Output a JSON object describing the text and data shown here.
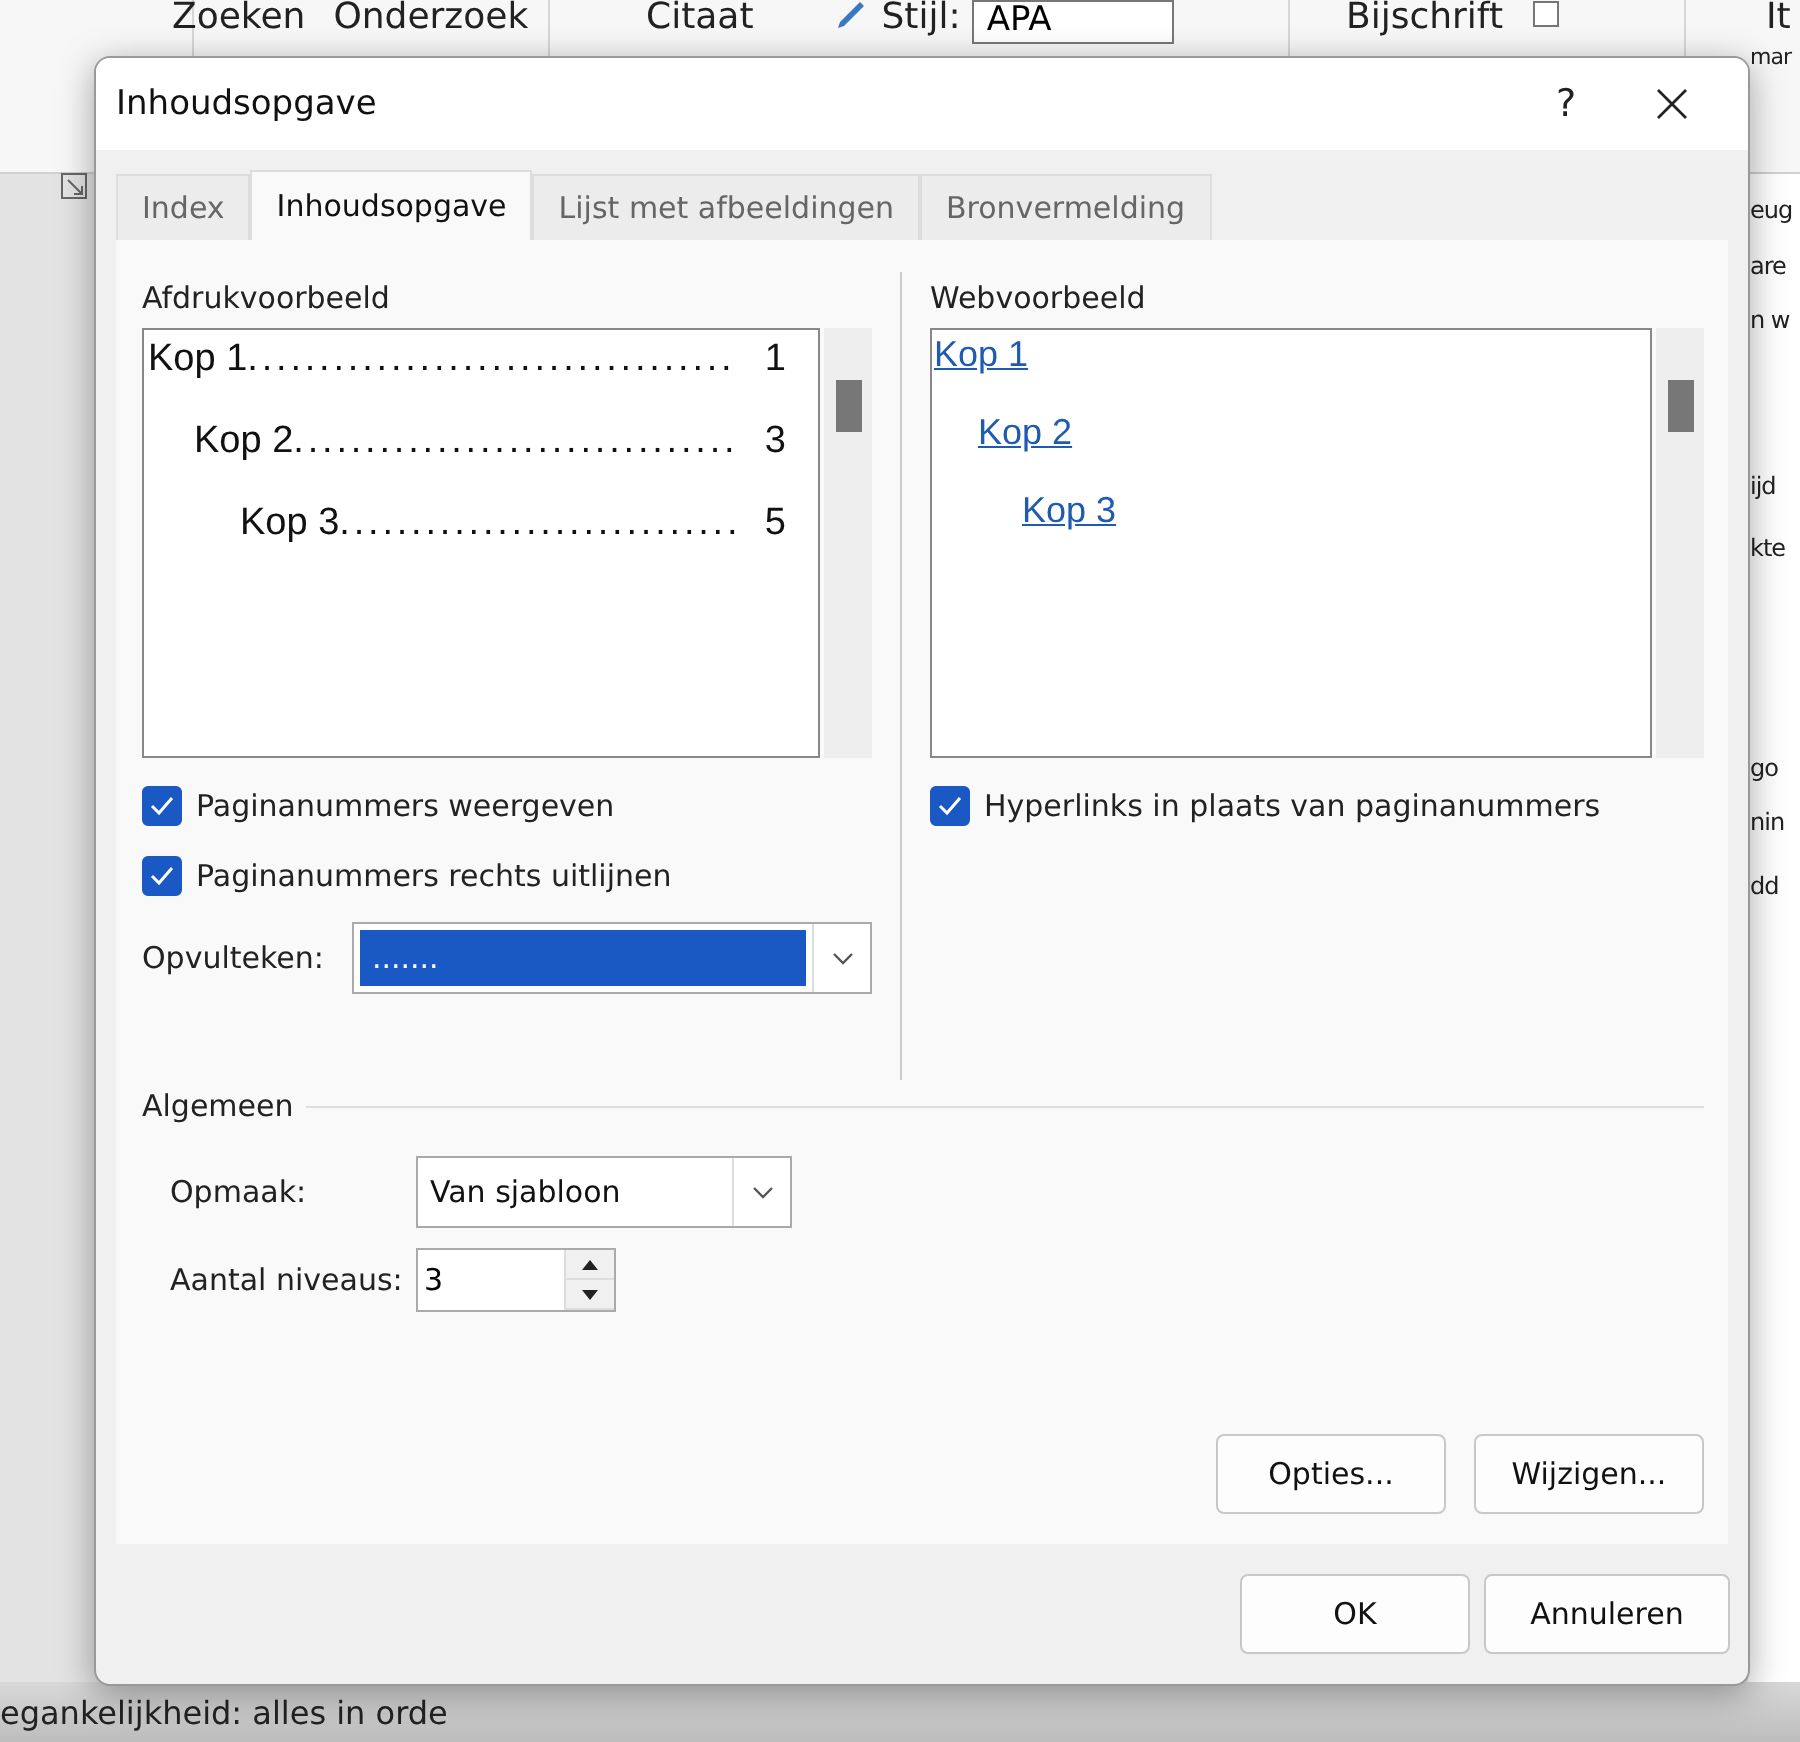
{
  "background": {
    "ribbon_items": [
      {
        "text": "Zoeken"
      },
      {
        "text": "Onderzoek"
      },
      {
        "text": "Citaat"
      },
      {
        "text": "Stijl:"
      },
      {
        "text": "APA"
      },
      {
        "text": "Bijschrift"
      },
      {
        "text": "It"
      }
    ],
    "ribbon_fragment": "mar",
    "document_fragments": [
      "eug",
      "are",
      "n w",
      "ijd",
      "kte",
      "go",
      "nin",
      "dd"
    ],
    "status_bar": "egankelijkheid: alles in orde"
  },
  "dialog": {
    "title": "Inhoudsopgave",
    "help": "?",
    "tabs": [
      {
        "label": "Index",
        "selected": false
      },
      {
        "label": "Inhoudsopgave",
        "selected": true
      },
      {
        "label": "Lijst met afbeeldingen",
        "selected": false
      },
      {
        "label": "Bronvermelding",
        "selected": false
      }
    ],
    "print_preview": {
      "label": "Afdrukvoorbeeld",
      "entries": [
        {
          "text": "Kop 1",
          "leader": "..................................",
          "page": "1"
        },
        {
          "text": "Kop 2",
          "leader": "...............................",
          "page": "3"
        },
        {
          "text": "Kop 3",
          "leader": " ............................",
          "page": "5"
        }
      ]
    },
    "print_options": [
      {
        "label": "Paginanummers weergeven",
        "checked": true
      },
      {
        "label": "Paginanummers rechts uitlijnen",
        "checked": true
      }
    ],
    "fill_char": {
      "label": "Opvulteken:",
      "value": "......."
    },
    "web_preview": {
      "label": "Webvoorbeeld",
      "entries": [
        "Kop 1",
        "Kop 2",
        "Kop 3"
      ]
    },
    "web_options": [
      {
        "label": "Hyperlinks in plaats van paginanummers",
        "checked": true
      }
    ],
    "general": {
      "label": "Algemeen",
      "format_label": "Opmaak:",
      "format_value": "Van sjabloon",
      "levels_label": "Aantal niveaus:",
      "levels_value": "3"
    },
    "panel_buttons": [
      "Opties...",
      "Wijzigen..."
    ],
    "buttons": [
      "OK",
      "Annuleren"
    ]
  }
}
